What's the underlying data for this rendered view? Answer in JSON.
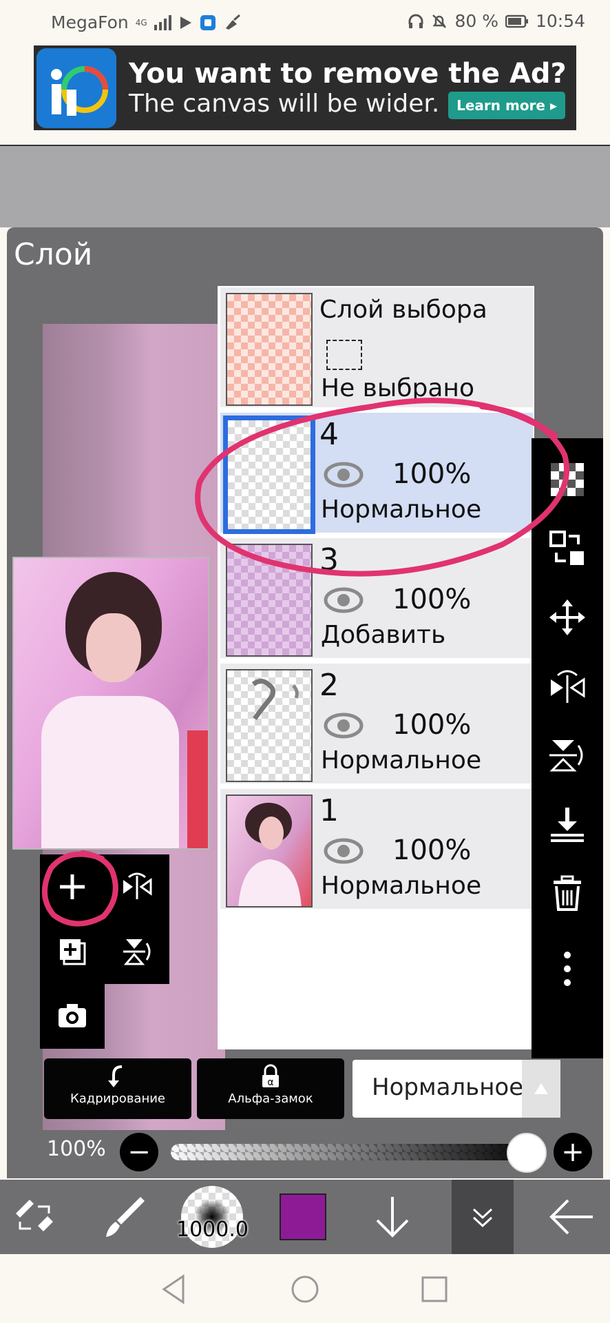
{
  "status_bar": {
    "carrier": "MegaFon",
    "network": "4G",
    "battery": "80 %",
    "time": "10:54"
  },
  "ad": {
    "title": "You want to remove the Ad?",
    "subtitle": "The canvas will be wider.",
    "cta": "Learn more ▸"
  },
  "panel": {
    "title": "Слой"
  },
  "selection_layer": {
    "title": "Слой выбора",
    "state": "Не выбрано"
  },
  "layers": [
    {
      "number": "4",
      "opacity": "100%",
      "mode": "Нормальное",
      "selected": true
    },
    {
      "number": "3",
      "opacity": "100%",
      "mode": "Добавить",
      "selected": false
    },
    {
      "number": "2",
      "opacity": "100%",
      "mode": "Нормальное",
      "selected": false
    },
    {
      "number": "1",
      "opacity": "100%",
      "mode": "Нормальное",
      "selected": false
    }
  ],
  "buttons": {
    "crop_label": "Кадрирование",
    "alpha_lock_label": "Альфа-замок"
  },
  "blend_mode": {
    "value": "Нормальное"
  },
  "opacity": {
    "label": "100%",
    "value": 1.0
  },
  "bottom_bar": {
    "brush_size": "1000.0",
    "color": "#8e1b96"
  },
  "colors": {
    "selected_layer_border": "#2d6cdf",
    "selected_layer_bg": "#d3ddf3",
    "annotation": "#e0336f",
    "panel_bg": "#6e6d70"
  },
  "icons": {
    "add_layer": "plus-icon",
    "flip_horizontal": "flip-horizontal-icon",
    "duplicate": "duplicate-icon",
    "flip_vertical": "flip-vertical-icon",
    "camera": "camera-icon",
    "right_tools": [
      "checker-icon",
      "layer-swap-icon",
      "move-icon",
      "flip-horizontal-icon",
      "flip-vertical-icon",
      "merge-down-icon",
      "trash-icon",
      "more-icon"
    ]
  }
}
